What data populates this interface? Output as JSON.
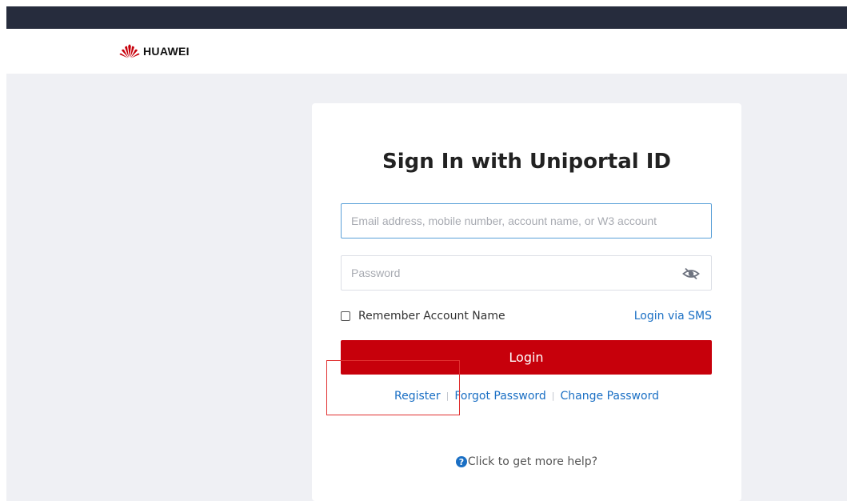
{
  "header": {
    "brand": "HUAWEI",
    "logo_icon": "huawei-flower-logo",
    "logo_color": "#c7000b",
    "topbar_color": "#262c3d"
  },
  "login": {
    "title": "Sign In with Uniportal ID",
    "account_placeholder": "Email address, mobile number, account name, or W3 account",
    "password_placeholder": "Password",
    "password_toggle_icon": "eye-hidden-icon",
    "remember_label": "Remember Account Name",
    "remember_checked": false,
    "sms_link": "Login via SMS",
    "login_button": "Login",
    "button_color": "#c7000b",
    "link_color": "#1a6fc4"
  },
  "links": {
    "register": "Register",
    "forgot_password": "Forgot Password",
    "change_password": "Change Password",
    "separator": "|"
  },
  "help": {
    "icon_glyph": "?",
    "text": "Click to get more help?"
  }
}
